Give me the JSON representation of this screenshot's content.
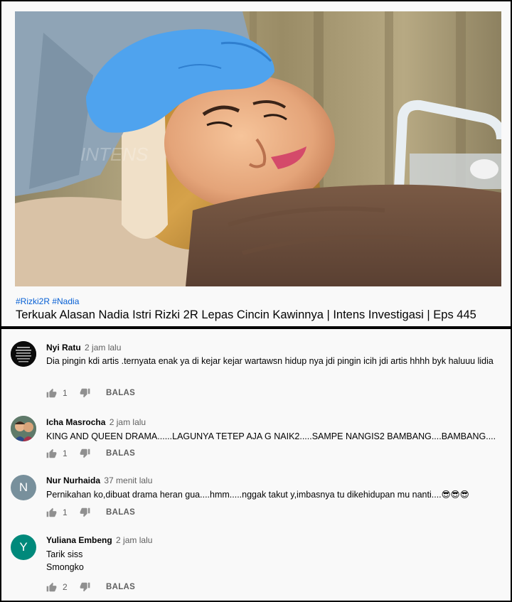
{
  "video": {
    "hashtags": "#Rizki2R #Nadia",
    "title": "Terkuak Alasan Nadia Istri Rizki 2R Lepas Cincin Kawinnya | Intens Investigasi | Eps 445"
  },
  "comments": [
    {
      "author": "Nyi Ratu",
      "time": "2 jam lalu",
      "text": "Dia pingin kdi artis .ternyata enak ya di kejar kejar wartawsn hidup nya jdi pingin icih jdi artis hhhh byk haluuu lidia",
      "likes": "1",
      "reply_label": "BALAS",
      "avatar_initial": ""
    },
    {
      "author": "Icha Masrocha",
      "time": "2 jam lalu",
      "text": "KING AND QUEEN DRAMA......LAGUNYA TETEP AJA G NAIK2.....SAMPE NANGIS2 BAMBANG....BAMBANG....",
      "likes": "1",
      "reply_label": "BALAS",
      "avatar_initial": ""
    },
    {
      "author": "Nur Nurhaida",
      "time": "37 menit lalu",
      "text": "Pernikahan ko,dibuat drama heran gua....hmm.....nggak takut y,imbasnya tu dikehidupan mu nanti....😎😎😎",
      "likes": "1",
      "reply_label": "BALAS",
      "avatar_initial": "N",
      "avatar_color": "#78909c"
    },
    {
      "author": "Yuliana Embeng",
      "time": "2 jam lalu",
      "text_line1": "Tarik siss",
      "text_line2": "Smongko",
      "likes": "2",
      "reply_label": "BALAS",
      "avatar_initial": "Y",
      "avatar_color": "#00897b"
    }
  ]
}
